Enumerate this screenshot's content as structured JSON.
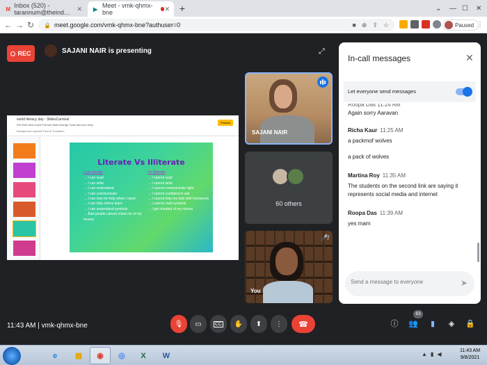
{
  "browser": {
    "tabs": [
      {
        "label": "Inbox (520) - tarannum@theind…",
        "favicon": "gmail-icon"
      },
      {
        "label": "Meet - vmk-qhmx-bne",
        "favicon": "meet-icon",
        "active": true
      }
    ],
    "url": "meet.google.com/vmk-qhmx-bne?authuser=0",
    "profile_status": "Paused"
  },
  "meet": {
    "rec_label": "REC",
    "presenter_text": "SAJANI NAIR is presenting",
    "slides": {
      "doc_title": "world literacy day - SlidesCarnival",
      "menu": "File  Edit  View  Insert  Format  Slide  Arrange  Tools  Add-ons  Help",
      "toolbar": "Background   Layout▾   Theme   Transition",
      "present_label": "Present",
      "slide_title": "Literate Vs Illiterate",
      "left_header": "I can literally",
      "left_items": [
        "I can read",
        "I can write",
        "I can understand",
        "I can communicate",
        "I can look for help when I need",
        "I can help others learn",
        "I can understand symbols",
        "Bad people cannot cheat me of my money"
      ],
      "right_header": "I'm Illiterate",
      "right_items": [
        "I cannot read",
        "I cannot write",
        "I cannot communicate right",
        "I cannot confident to ask",
        "I cannot help my kids with homework",
        "I cannot read symbols",
        "I get cheated of my money"
      ]
    },
    "tiles": {
      "presenter_name": "SAJANI NAIR",
      "others_label": "60 others",
      "self_label": "You"
    },
    "chat": {
      "title": "In-call messages",
      "toggle_label": "Let everyone send messages",
      "toggle_on": true,
      "partial_meta": "Roopa Das  11:24 AM",
      "messages": [
        {
          "sender": "",
          "time": "",
          "texts": [
            "Again sorry Aaravan"
          ]
        },
        {
          "sender": "Richa Kaur",
          "time": "11:25 AM",
          "texts": [
            "a packmof wolves",
            "a pack of wolves"
          ]
        },
        {
          "sender": "Martina Roy",
          "time": "11:35 AM",
          "texts": [
            "The students on the second link are saying it represents social media and internet"
          ]
        },
        {
          "sender": "Roopa Das",
          "time": "11:39 AM",
          "texts": [
            "yes mam"
          ]
        }
      ],
      "input_placeholder": "Send a message to everyone"
    },
    "bottom": {
      "time_meeting": "11:43 AM  |  vmk-qhmx-bne",
      "participant_count": "63"
    }
  },
  "taskbar": {
    "clock_time": "11:43 AM",
    "clock_date": "9/8/2021"
  },
  "colors": {
    "accent": "#1a73e8",
    "danger": "#ea4335",
    "meet_bg": "#202124"
  }
}
